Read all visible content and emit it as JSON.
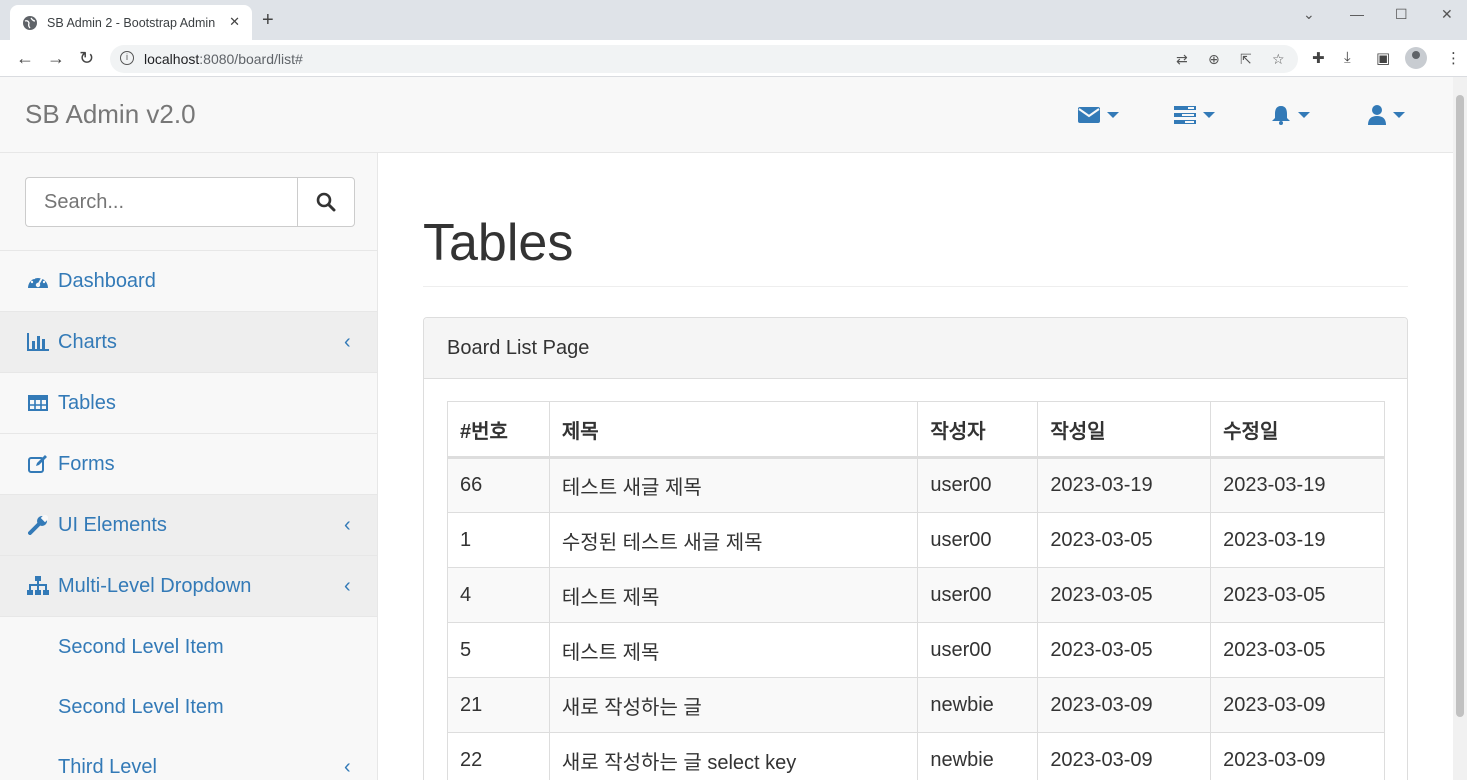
{
  "browser": {
    "tab_title": "SB Admin 2 - Bootstrap Admin",
    "tab_close": "✕",
    "new_tab": "+",
    "url_host": "localhost",
    "url_path": ":8080/board/list#"
  },
  "navbar": {
    "brand": "SB Admin v2.0",
    "icons": [
      "envelope-icon",
      "tasks-icon",
      "bell-icon",
      "user-icon"
    ]
  },
  "sidebar": {
    "search_placeholder": "Search...",
    "items": [
      {
        "label": "Dashboard",
        "icon": "dashboard-icon",
        "arrow": ""
      },
      {
        "label": "Charts",
        "icon": "bar-chart-icon",
        "arrow": "‹"
      },
      {
        "label": "Tables",
        "icon": "table-icon",
        "arrow": ""
      },
      {
        "label": "Forms",
        "icon": "edit-icon",
        "arrow": ""
      },
      {
        "label": "UI Elements",
        "icon": "wrench-icon",
        "arrow": "‹"
      },
      {
        "label": "Multi-Level Dropdown",
        "icon": "sitemap-icon",
        "arrow": "‹"
      }
    ],
    "sub_items": [
      {
        "label": "Second Level Item",
        "arrow": ""
      },
      {
        "label": "Second Level Item",
        "arrow": ""
      },
      {
        "label": "Third Level",
        "arrow": "‹"
      }
    ]
  },
  "main": {
    "title": "Tables",
    "panel_title": "Board List Page",
    "table": {
      "headers": [
        "#번호",
        "제목",
        "작성자",
        "작성일",
        "수정일"
      ],
      "rows": [
        [
          "66",
          "테스트 새글 제목",
          "user00",
          "2023-03-19",
          "2023-03-19"
        ],
        [
          "1",
          "수정된 테스트 새글 제목",
          "user00",
          "2023-03-05",
          "2023-03-19"
        ],
        [
          "4",
          "테스트 제목",
          "user00",
          "2023-03-05",
          "2023-03-05"
        ],
        [
          "5",
          "테스트 제목",
          "user00",
          "2023-03-05",
          "2023-03-05"
        ],
        [
          "21",
          "새로 작성하는 글",
          "newbie",
          "2023-03-09",
          "2023-03-09"
        ],
        [
          "22",
          "새로 작성하는 글 select key",
          "newbie",
          "2023-03-09",
          "2023-03-09"
        ]
      ]
    }
  },
  "colors": {
    "link": "#337ab7",
    "navbar_bg": "#f8f8f8",
    "border": "#ddd"
  }
}
